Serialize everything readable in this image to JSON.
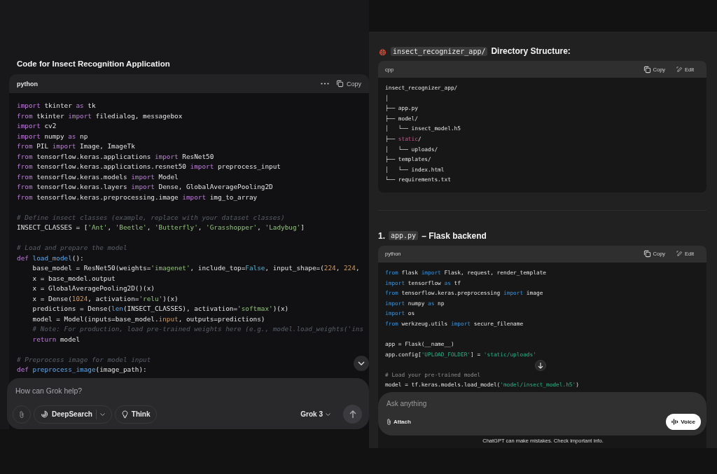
{
  "left_chat": {
    "heading": "Code for Insect Recognition Application",
    "code_block": {
      "language": "python",
      "copy_label": "Copy",
      "lines": [
        {
          "kind": "code",
          "tokens": [
            {
              "kind": "kw",
              "text": "import"
            },
            {
              "kind": "p",
              "text": " tkinter "
            },
            {
              "kind": "kw",
              "text": "as"
            },
            {
              "kind": "p",
              "text": " tk"
            }
          ]
        },
        {
          "kind": "code",
          "tokens": [
            {
              "kind": "kw",
              "text": "from"
            },
            {
              "kind": "p",
              "text": " tkinter "
            },
            {
              "kind": "kw",
              "text": "import"
            },
            {
              "kind": "p",
              "text": " filedialog, messagebox"
            }
          ]
        },
        {
          "kind": "code",
          "tokens": [
            {
              "kind": "kw",
              "text": "import"
            },
            {
              "kind": "p",
              "text": " cv2"
            }
          ]
        },
        {
          "kind": "code",
          "tokens": [
            {
              "kind": "kw",
              "text": "import"
            },
            {
              "kind": "p",
              "text": " numpy "
            },
            {
              "kind": "kw",
              "text": "as"
            },
            {
              "kind": "p",
              "text": " np"
            }
          ]
        },
        {
          "kind": "code",
          "tokens": [
            {
              "kind": "kw",
              "text": "from"
            },
            {
              "kind": "p",
              "text": " PIL "
            },
            {
              "kind": "kw",
              "text": "import"
            },
            {
              "kind": "p",
              "text": " Image, ImageTk"
            }
          ]
        },
        {
          "kind": "code",
          "tokens": [
            {
              "kind": "kw",
              "text": "from"
            },
            {
              "kind": "p",
              "text": " tensorflow.keras.applications "
            },
            {
              "kind": "kw",
              "text": "import"
            },
            {
              "kind": "p",
              "text": " ResNet50"
            }
          ]
        },
        {
          "kind": "code",
          "tokens": [
            {
              "kind": "kw",
              "text": "from"
            },
            {
              "kind": "p",
              "text": " tensorflow.keras.applications.resnet50 "
            },
            {
              "kind": "kw",
              "text": "import"
            },
            {
              "kind": "p",
              "text": " preprocess_input"
            }
          ]
        },
        {
          "kind": "code",
          "tokens": [
            {
              "kind": "kw",
              "text": "from"
            },
            {
              "kind": "p",
              "text": " tensorflow.keras.models "
            },
            {
              "kind": "kw",
              "text": "import"
            },
            {
              "kind": "p",
              "text": " Model"
            }
          ]
        },
        {
          "kind": "code",
          "tokens": [
            {
              "kind": "kw",
              "text": "from"
            },
            {
              "kind": "p",
              "text": " tensorflow.keras.layers "
            },
            {
              "kind": "kw",
              "text": "import"
            },
            {
              "kind": "p",
              "text": " Dense, GlobalAveragePooling2D"
            }
          ]
        },
        {
          "kind": "code",
          "tokens": [
            {
              "kind": "kw",
              "text": "from"
            },
            {
              "kind": "p",
              "text": " tensorflow.keras.preprocessing.image "
            },
            {
              "kind": "kw",
              "text": "import"
            },
            {
              "kind": "p",
              "text": " img_to_array"
            }
          ]
        },
        {
          "kind": "blank"
        },
        {
          "kind": "code",
          "tokens": [
            {
              "kind": "com",
              "text": "# Define insect classes (example, replace with your dataset classes)"
            }
          ]
        },
        {
          "kind": "code",
          "tokens": [
            {
              "kind": "p",
              "text": "INSECT_CLASSES = ["
            },
            {
              "kind": "s",
              "text": "'Ant'"
            },
            {
              "kind": "p",
              "text": ", "
            },
            {
              "kind": "s",
              "text": "'Beetle'"
            },
            {
              "kind": "p",
              "text": ", "
            },
            {
              "kind": "s",
              "text": "'Butterfly'"
            },
            {
              "kind": "p",
              "text": ", "
            },
            {
              "kind": "s",
              "text": "'Grasshopper'"
            },
            {
              "kind": "p",
              "text": ", "
            },
            {
              "kind": "s",
              "text": "'Ladybug'"
            },
            {
              "kind": "p",
              "text": "]"
            }
          ]
        },
        {
          "kind": "blank"
        },
        {
          "kind": "code",
          "tokens": [
            {
              "kind": "com",
              "text": "# Load and prepare the model"
            }
          ]
        },
        {
          "kind": "code",
          "tokens": [
            {
              "kind": "kw",
              "text": "def "
            },
            {
              "kind": "fn",
              "text": "load_model"
            },
            {
              "kind": "p",
              "text": "():"
            }
          ]
        },
        {
          "kind": "code",
          "tokens": [
            {
              "kind": "p",
              "text": "    base_model = ResNet50(weights="
            },
            {
              "kind": "s",
              "text": "'imagenet'"
            },
            {
              "kind": "p",
              "text": ", include_top="
            },
            {
              "kind": "c",
              "text": "False"
            },
            {
              "kind": "p",
              "text": ", input_shape=("
            },
            {
              "kind": "n",
              "text": "224"
            },
            {
              "kind": "p",
              "text": ", "
            },
            {
              "kind": "n",
              "text": "224"
            },
            {
              "kind": "p",
              "text": ","
            }
          ]
        },
        {
          "kind": "code",
          "tokens": [
            {
              "kind": "p",
              "text": "    x = base_model.output"
            }
          ]
        },
        {
          "kind": "code",
          "tokens": [
            {
              "kind": "p",
              "text": "    x = GlobalAveragePooling2D()(x)"
            }
          ]
        },
        {
          "kind": "code",
          "tokens": [
            {
              "kind": "p",
              "text": "    x = Dense("
            },
            {
              "kind": "n",
              "text": "1024"
            },
            {
              "kind": "p",
              "text": ", activation="
            },
            {
              "kind": "s",
              "text": "'relu'"
            },
            {
              "kind": "p",
              "text": ")(x)"
            }
          ]
        },
        {
          "kind": "code",
          "tokens": [
            {
              "kind": "p",
              "text": "    predictions = Dense("
            },
            {
              "kind": "fn",
              "text": "len"
            },
            {
              "kind": "p",
              "text": "(INSECT_CLASSES), activation="
            },
            {
              "kind": "s",
              "text": "'softmax'"
            },
            {
              "kind": "p",
              "text": ")(x)"
            }
          ]
        },
        {
          "kind": "code",
          "tokens": [
            {
              "kind": "p",
              "text": "    model = Model(inputs=base_model."
            },
            {
              "kind": "n",
              "text": "input"
            },
            {
              "kind": "p",
              "text": ", outputs=predictions)"
            }
          ]
        },
        {
          "kind": "code",
          "tokens": [
            {
              "kind": "com",
              "text": "    # Note: For production, load pre-trained weights here (e.g., model.load_weights('ins"
            }
          ]
        },
        {
          "kind": "code",
          "tokens": [
            {
              "kind": "kw",
              "text": "    return"
            },
            {
              "kind": "p",
              "text": " model"
            }
          ]
        },
        {
          "kind": "blank"
        },
        {
          "kind": "code",
          "tokens": [
            {
              "kind": "com",
              "text": "# Preprocess image for model input"
            }
          ]
        },
        {
          "kind": "code",
          "tokens": [
            {
              "kind": "kw",
              "text": "def "
            },
            {
              "kind": "fn",
              "text": "preprocess_image"
            },
            {
              "kind": "p",
              "text": "(image_path):"
            }
          ]
        }
      ]
    },
    "composer": {
      "placeholder": "How can Grok help?",
      "deepsearch_label": "DeepSearch",
      "think_label": "Think",
      "model_label": "Grok 3"
    }
  },
  "right_chat": {
    "structure_heading": {
      "code": "insect_recognizer_app/",
      "text": "Directory Structure:"
    },
    "tree_block": {
      "language": "cpp",
      "copy_label": "Copy",
      "edit_label": "Edit",
      "lines": [
        {
          "kind": "code",
          "tokens": [
            {
              "kind": "p",
              "text": "insect_recognizer_app/"
            }
          ]
        },
        {
          "kind": "code",
          "tokens": [
            {
              "kind": "p",
              "text": "│"
            }
          ]
        },
        {
          "kind": "code",
          "tokens": [
            {
              "kind": "p",
              "text": "├── app.py"
            }
          ]
        },
        {
          "kind": "code",
          "tokens": [
            {
              "kind": "p",
              "text": "├── model/"
            }
          ]
        },
        {
          "kind": "code",
          "tokens": [
            {
              "kind": "p",
              "text": "│   └── insect_model.h5"
            }
          ]
        },
        {
          "kind": "code",
          "tokens": [
            {
              "kind": "p",
              "text": "├── "
            },
            {
              "kind": "tag",
              "text": "static"
            },
            {
              "kind": "p",
              "text": "/"
            }
          ]
        },
        {
          "kind": "code",
          "tokens": [
            {
              "kind": "p",
              "text": "│   └── uploads/"
            }
          ]
        },
        {
          "kind": "code",
          "tokens": [
            {
              "kind": "p",
              "text": "├── templates/"
            }
          ]
        },
        {
          "kind": "code",
          "tokens": [
            {
              "kind": "p",
              "text": "│   └── index.html"
            }
          ]
        },
        {
          "kind": "code",
          "tokens": [
            {
              "kind": "p",
              "text": "└── requirements.txt"
            }
          ]
        }
      ]
    },
    "app_heading": {
      "number": "1.",
      "code": "app.py",
      "text": "– Flask backend"
    },
    "app_block": {
      "language": "python",
      "copy_label": "Copy",
      "edit_label": "Edit",
      "lines": [
        {
          "kind": "code",
          "tokens": [
            {
              "kind": "kw",
              "text": "from"
            },
            {
              "kind": "p",
              "text": " flask "
            },
            {
              "kind": "kw",
              "text": "import"
            },
            {
              "kind": "p",
              "text": " Flask, request, render_template"
            }
          ]
        },
        {
          "kind": "code",
          "tokens": [
            {
              "kind": "kw",
              "text": "import"
            },
            {
              "kind": "p",
              "text": " tensorflow "
            },
            {
              "kind": "kw",
              "text": "as"
            },
            {
              "kind": "p",
              "text": " tf"
            }
          ]
        },
        {
          "kind": "code",
          "tokens": [
            {
              "kind": "kw",
              "text": "from"
            },
            {
              "kind": "p",
              "text": " tensorflow.keras.preprocessing "
            },
            {
              "kind": "kw",
              "text": "import"
            },
            {
              "kind": "p",
              "text": " image"
            }
          ]
        },
        {
          "kind": "code",
          "tokens": [
            {
              "kind": "kw",
              "text": "import"
            },
            {
              "kind": "p",
              "text": " numpy "
            },
            {
              "kind": "kw",
              "text": "as"
            },
            {
              "kind": "p",
              "text": " np"
            }
          ]
        },
        {
          "kind": "code",
          "tokens": [
            {
              "kind": "kw",
              "text": "import"
            },
            {
              "kind": "p",
              "text": " os"
            }
          ]
        },
        {
          "kind": "code",
          "tokens": [
            {
              "kind": "kw",
              "text": "from"
            },
            {
              "kind": "p",
              "text": " werkzeug.utils "
            },
            {
              "kind": "kw",
              "text": "import"
            },
            {
              "kind": "p",
              "text": " secure_filename"
            }
          ]
        },
        {
          "kind": "blank"
        },
        {
          "kind": "code",
          "tokens": [
            {
              "kind": "p",
              "text": "app = Flask(__name__)"
            }
          ]
        },
        {
          "kind": "code",
          "tokens": [
            {
              "kind": "p",
              "text": "app.config["
            },
            {
              "kind": "s",
              "text": "'UPLOAD_FOLDER'"
            },
            {
              "kind": "p",
              "text": "] = "
            },
            {
              "kind": "s",
              "text": "'static/uploads'"
            }
          ]
        },
        {
          "kind": "blank"
        },
        {
          "kind": "code",
          "tokens": [
            {
              "kind": "com",
              "text": "# Load your pre-trained model"
            }
          ]
        },
        {
          "kind": "code",
          "tokens": [
            {
              "kind": "p",
              "text": "model = tf.keras.models.load_model("
            },
            {
              "kind": "s",
              "text": "'model/insect_model.h5'"
            },
            {
              "kind": "p",
              "text": ")"
            }
          ]
        }
      ]
    },
    "composer": {
      "placeholder": "Ask anything",
      "attach_label": "Attach",
      "voice_label": "Voice"
    },
    "disclaimer": "ChatGPT can make mistakes. Check important info."
  }
}
